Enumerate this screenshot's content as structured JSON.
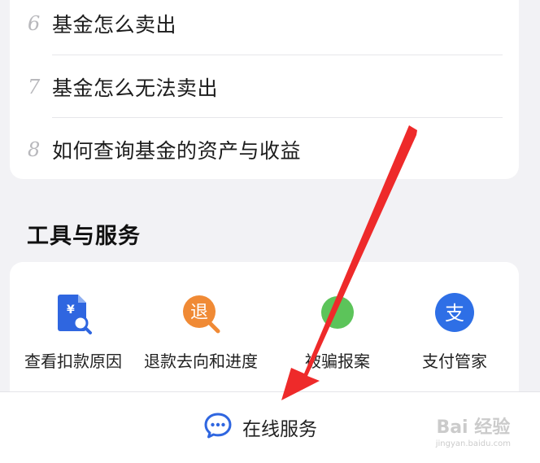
{
  "faq": {
    "items": [
      {
        "num": "6",
        "text": "基金怎么卖出"
      },
      {
        "num": "7",
        "text": "基金怎么无法卖出"
      },
      {
        "num": "8",
        "text": "如何查询基金的资产与收益"
      }
    ]
  },
  "tools_section": {
    "title": "工具与服务",
    "items": [
      {
        "label": "查看扣款原因",
        "icon": "receipt-search-icon",
        "color": "#2f66e0"
      },
      {
        "label": "退款去向和进度",
        "icon": "refund-icon",
        "glyph": "退",
        "color": "#f08a35"
      },
      {
        "label": "被骗报案",
        "icon": "report-icon",
        "color": "#5cc45a",
        "obscured_prefix": "被"
      },
      {
        "label": "支付管家",
        "icon": "alipay-icon",
        "glyph": "支",
        "color": "#2e6fe6"
      }
    ]
  },
  "bottom_bar": {
    "online_service_label": "在线服务",
    "icon": "chat-bubble-icon"
  },
  "watermark": {
    "text": "Bai 经验",
    "sub": "jingyan.baidu.com"
  },
  "colors": {
    "annotation_arrow": "#ee2a2a",
    "accent_blue": "#2f66e0"
  }
}
